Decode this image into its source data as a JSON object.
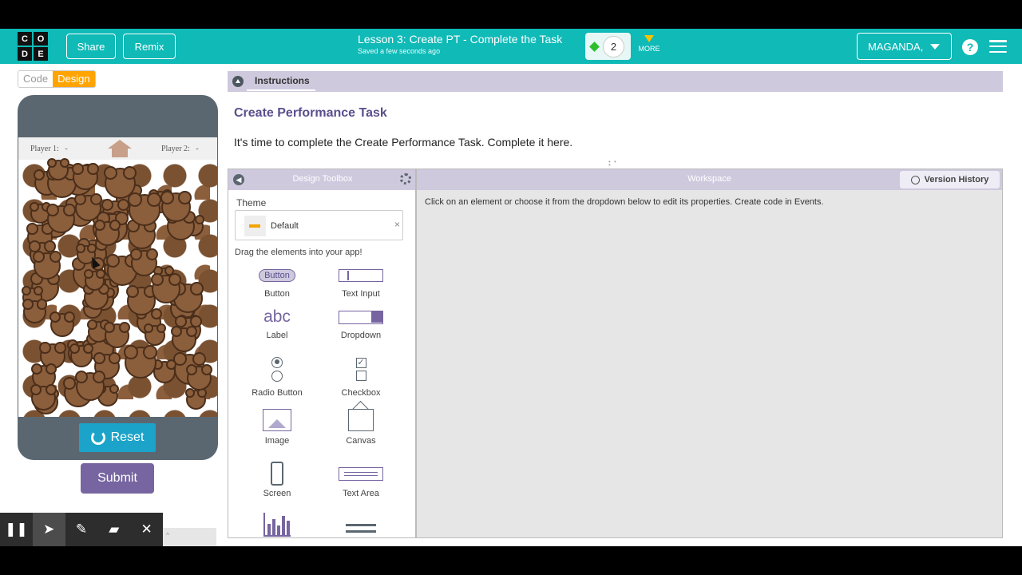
{
  "header": {
    "logo_letters": [
      "C",
      "O",
      "D",
      "E"
    ],
    "share_label": "Share",
    "remix_label": "Remix",
    "lesson_title": "Lesson 3: Create PT - Complete the Task",
    "saved_status": "Saved a few seconds ago",
    "progress_level": "2",
    "more_label": "MORE",
    "user_label": "MAGANDA,",
    "help_icon": "question-circle-icon",
    "menu_icon": "hamburger-icon",
    "brand_color": "#0fbab7"
  },
  "mode_toggle": {
    "code_label": "Code",
    "design_label": "Design",
    "active": "Design"
  },
  "app_preview": {
    "player1_label": "Player 1:",
    "player1_value": "-",
    "player2_label": "Player 2:",
    "player2_value": "-",
    "home_icon": "home-icon",
    "reset_label": "Reset",
    "submit_label": "Submit"
  },
  "draw_toolbar": {
    "tools": [
      "pause-icon",
      "pointer-icon",
      "pen-icon",
      "eraser-icon",
      "close-icon"
    ]
  },
  "instructions": {
    "tab_label": "Instructions",
    "title": "Create Performance Task",
    "text": "It's time to complete the Create Performance Task. Complete it here."
  },
  "toolbox": {
    "title": "Design Toolbox",
    "theme_label": "Theme",
    "theme_value": "Default",
    "drag_hint": "Drag the elements into your app!",
    "button_icon_text": "Button",
    "label_icon_text": "abc",
    "items": [
      "Button",
      "Text Input",
      "Label",
      "Dropdown",
      "Radio Button",
      "Checkbox",
      "Image",
      "Canvas",
      "Screen",
      "Text Area"
    ]
  },
  "workspace": {
    "title": "Workspace",
    "version_history_label": "Version History",
    "hint": "Click on an element or choose it from the dropdown below to edit its properties. Create code in Events."
  }
}
